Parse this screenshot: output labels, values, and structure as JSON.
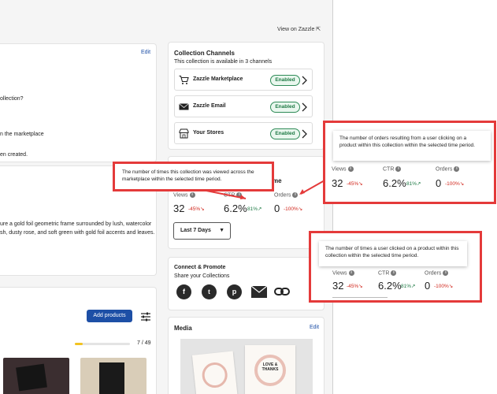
{
  "header": {
    "view_on_zazzle": "View on Zazzle"
  },
  "left": {
    "edit_label": "Edit",
    "text_lines": [
      "ollection?",
      "n the marketplace",
      "en created."
    ],
    "description_lines": [
      "ure a gold foil geometric frame surrounded by lush, watercolor",
      "sh, dusty rose, and soft green with gold foil accents and leaves."
    ],
    "add_products": "Add products",
    "progress_text": "7 / 49",
    "progress_fraction": 0.14
  },
  "channels": {
    "title": "Collection Channels",
    "subtitle": "This collection is available in 3 channels",
    "items": [
      {
        "label": "Zazzle Marketplace",
        "status": "Enabled",
        "icon": "cart-icon"
      },
      {
        "label": "Zazzle Email",
        "status": "Enabled",
        "icon": "mail-icon"
      },
      {
        "label": "Your Stores",
        "status": "Enabled",
        "icon": "store-icon"
      }
    ]
  },
  "performance": {
    "title_fragment": "me",
    "metrics": {
      "views": {
        "label": "Views",
        "value": "32",
        "change": "-45%↘"
      },
      "ctr": {
        "label": "CTR",
        "value": "6.2%",
        "change": "81%↗"
      },
      "orders": {
        "label": "Orders",
        "value": "0",
        "change": "-100%↘"
      }
    },
    "range": "Last 7 Days"
  },
  "connect": {
    "title": "Connect & Promote",
    "subtitle": "Share your Collections",
    "icons": [
      "facebook-icon",
      "twitter-icon",
      "pinterest-icon",
      "email-icon",
      "link-icon"
    ]
  },
  "media": {
    "title": "Media",
    "edit_label": "Edit",
    "card_text": "LOVE & THANKS"
  },
  "tooltips": {
    "views": "The number of times this collection was viewed across the marketplace within the selected time period.",
    "orders": "The number of orders resulting from a user clicking on a product within this collection within the selected time period.",
    "ctr": "The number of times a user clicked on a product within this collection within the selected time period."
  },
  "colors": {
    "accent": "#1d4fa6",
    "annotation": "#e43a3a",
    "positive": "#1f7a45",
    "negative": "#d1281e"
  }
}
